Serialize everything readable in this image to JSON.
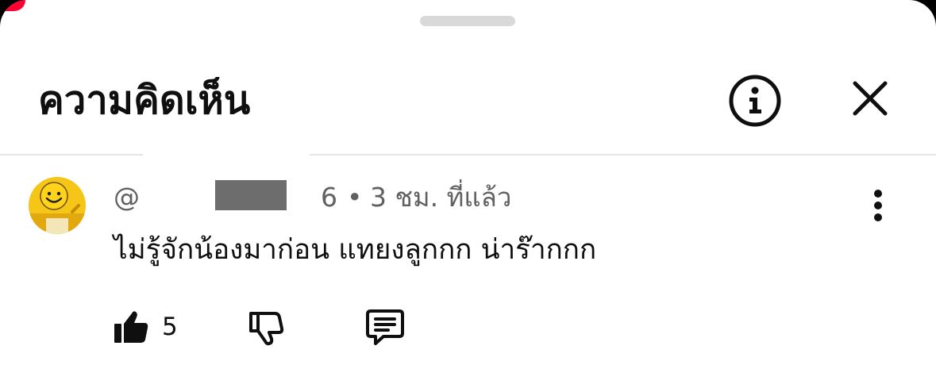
{
  "header": {
    "title": "ความคิดเห็น",
    "info_icon": "info-circle-icon",
    "close_icon": "close-x-icon"
  },
  "comment": {
    "handle_start": "@",
    "handle_end": "6",
    "separator": "•",
    "time_ago": "3 ชม. ที่แล้ว",
    "text": "ไม่รู้จักน้องมาก่อน แทยงลูกกก น่าร๊ากกก",
    "like_count": "5",
    "like_icon": "thumbs-up-filled-icon",
    "dislike_icon": "thumbs-down-outline-icon",
    "reply_icon": "reply-comment-icon",
    "more_icon": "more-vertical-icon"
  },
  "colors": {
    "primary_text": "#0f0f0f",
    "secondary_text": "#606060",
    "notification_red": "#ff0033",
    "avatar_yellow": "#f5c518"
  }
}
